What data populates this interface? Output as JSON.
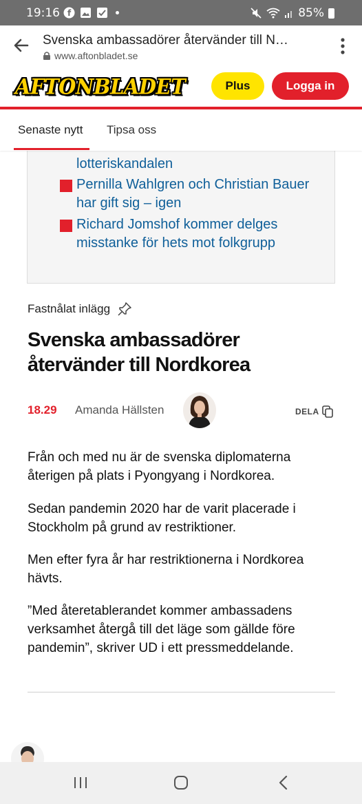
{
  "status_bar": {
    "time": "19:16",
    "battery": "85%"
  },
  "browser": {
    "page_title": "Svenska ambassadörer återvänder till N…",
    "url": "www.aftonbladet.se"
  },
  "site": {
    "logo": "AFTONBLADET",
    "plus_label": "Plus",
    "login_label": "Logga in",
    "colors": {
      "brand_red": "#e2202b",
      "brand_yellow": "#ffe400",
      "link_blue": "#0f5f99"
    }
  },
  "tabs": [
    {
      "label": "Senaste nytt",
      "active": true
    },
    {
      "label": "Tipsa oss",
      "active": false
    }
  ],
  "related": {
    "items": [
      {
        "text": "lotteriskandalen"
      },
      {
        "text": "Pernilla Wahlgren och Christian Bauer har gift sig – igen"
      },
      {
        "text": "Richard Jomshof kommer delges misstanke för hets mot folkgrupp"
      }
    ]
  },
  "article": {
    "pinned_label": "Fastnålat inlägg",
    "headline": "Svenska ambassadörer återvänder till Nordkorea",
    "time": "18.29",
    "author": "Amanda Hällsten",
    "share_label": "DELA",
    "paragraphs": [
      "Från och med nu är de svenska diplomaterna återigen på plats i Pyongyang i Nordkorea.",
      "Sedan pandemin 2020 har de varit placerade i Stockholm på grund av restriktioner.",
      "Men efter fyra år har restriktionerna i Nordkorea hävts.",
      "”Med återetablerandet kommer ambassadens verksamhet återgå till det läge som gällde före pandemin”, skriver UD i ett pressmeddelande."
    ]
  },
  "icons": {
    "back": "back-arrow-icon",
    "lock": "lock-icon",
    "menu": "more-vert-icon",
    "pin": "pin-icon",
    "share": "copy-icon",
    "nav_recents": "recents-icon",
    "nav_home": "home-icon",
    "nav_back": "nav-back-icon"
  }
}
